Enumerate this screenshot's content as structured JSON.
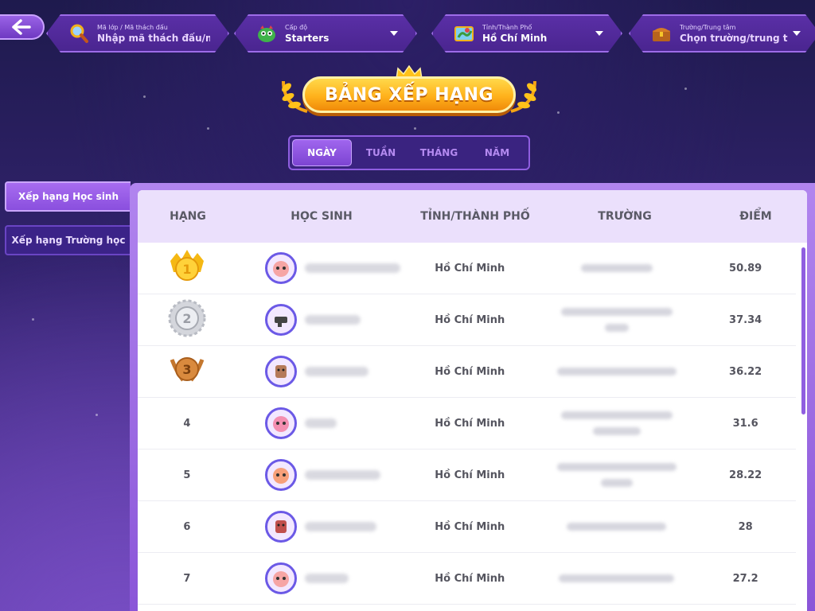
{
  "header": {
    "class_code": {
      "label": "Mã lớp / Mã thách đấu",
      "placeholder": "Nhập mã thách đấu/mã",
      "icon": "magnifier-icon"
    },
    "level": {
      "label": "Cấp độ",
      "value": "Starters",
      "icon": "monster-icon"
    },
    "province": {
      "label": "Tỉnh/Thành Phố",
      "value": "Hồ Chí Minh",
      "icon": "map-icon"
    },
    "school": {
      "label": "Trường/Trung tâm",
      "placeholder": "Chọn trường/trung tâm",
      "icon": "treasure-chest-icon"
    }
  },
  "title": "BẢNG XẾP HẠNG",
  "period_tabs": [
    {
      "label": "NGÀY",
      "active": true
    },
    {
      "label": "TUẦN",
      "active": false
    },
    {
      "label": "THÁNG",
      "active": false
    },
    {
      "label": "NĂM",
      "active": false
    }
  ],
  "side_tabs": [
    {
      "label": "Xếp hạng Học sinh",
      "active": true
    },
    {
      "label": "Xếp hạng Trường học",
      "active": false
    }
  ],
  "table": {
    "headers": [
      "HẠNG",
      "HỌC SINH",
      "TỈNH/THÀNH PHỐ",
      "TRƯỜNG",
      "ĐIỂM"
    ],
    "rows": [
      {
        "rank": "1",
        "rank_icon": "gold-medal-icon",
        "province": "Hồ Chí Minh",
        "score": "50.89"
      },
      {
        "rank": "2",
        "rank_icon": "silver-medal-icon",
        "province": "Hồ Chí Minh",
        "score": "37.34"
      },
      {
        "rank": "3",
        "rank_icon": "bronze-medal-icon",
        "province": "Hồ Chí Minh",
        "score": "36.22"
      },
      {
        "rank": "4",
        "province": "Hồ Chí Minh",
        "score": "31.6"
      },
      {
        "rank": "5",
        "province": "Hồ Chí Minh",
        "score": "28.22"
      },
      {
        "rank": "6",
        "province": "Hồ Chí Minh",
        "score": "28"
      },
      {
        "rank": "7",
        "province": "Hồ Chí Minh",
        "score": "27.2"
      }
    ]
  },
  "colors": {
    "accent": "#8a4fde",
    "gold": "#ffc21a",
    "header_bg": "#ebe0fc"
  }
}
